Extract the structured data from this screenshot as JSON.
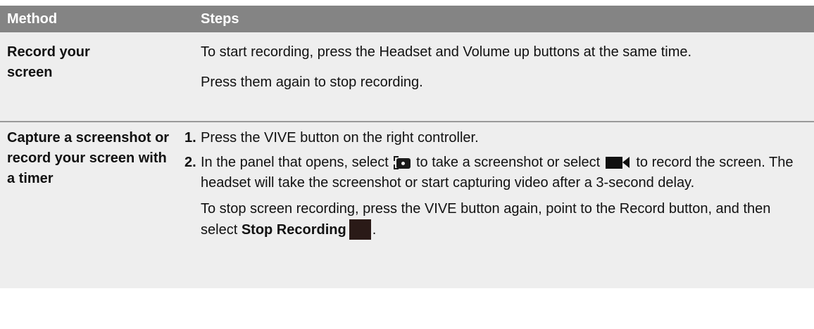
{
  "header": {
    "method": "Method",
    "steps": "Steps"
  },
  "rows": [
    {
      "method": "Record your screen",
      "paragraphs": [
        "To start recording, press the Headset and Volume up buttons at the same time.",
        "Press them again to stop recording."
      ]
    },
    {
      "method": "Capture a screenshot or record your screen with a timer",
      "steps": [
        {
          "num": "1.",
          "text": "Press the VIVE button on the right controller."
        },
        {
          "num": "2.",
          "text_a": "In the panel that opens, select",
          "text_b": "to take a screenshot or select",
          "text_c": "to record the screen. The headset will take the screenshot or start capturing video after a 3-second delay."
        }
      ],
      "note_a": "To stop screen recording, press the VIVE button again, point to the Record button, and then select",
      "note_bold": "Stop Recording",
      "note_end": "."
    }
  ],
  "icons": {
    "screenshot": "camera-screenshot-icon",
    "video": "video-camera-icon",
    "stop": "stop-recording-icon"
  }
}
